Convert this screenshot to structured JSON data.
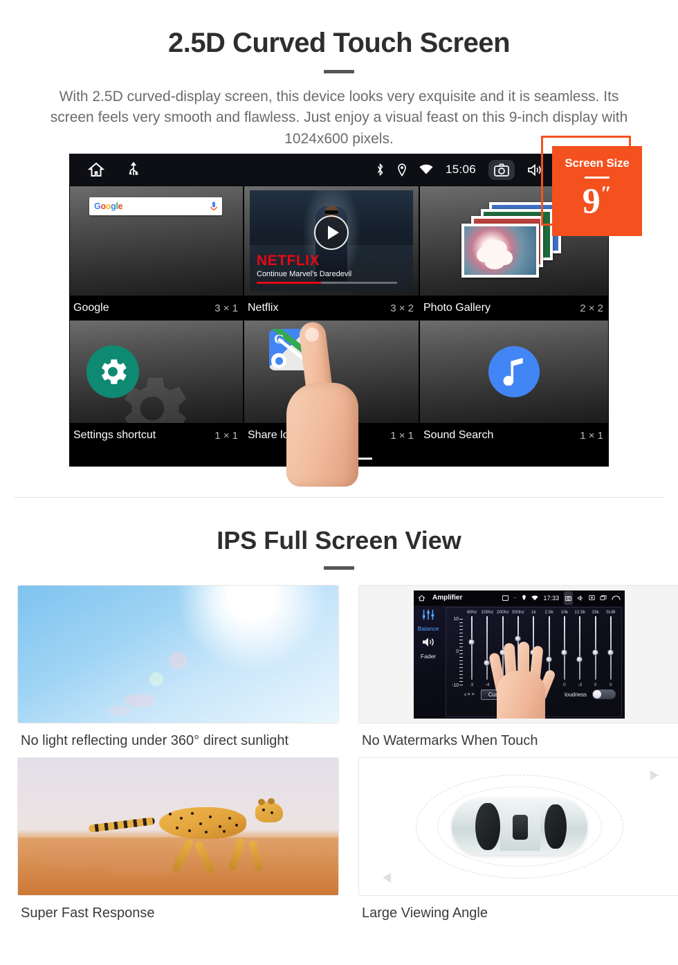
{
  "section1": {
    "title": "2.5D Curved Touch Screen",
    "description": "With 2.5D curved-display screen, this device looks very exquisite and it is seamless. Its screen feels very smooth and flawless. Just enjoy a visual feast on this 9-inch display with 1024x600 pixels.",
    "badge": {
      "label": "Screen Size",
      "value": "9",
      "unit": "″"
    },
    "accent_color": "#F4511E",
    "device": {
      "statusbar": {
        "time": "15:06",
        "left_icons": [
          "home-icon",
          "usb-icon"
        ],
        "right_icons": [
          "bluetooth-icon",
          "location-icon",
          "wifi-icon",
          "camera-icon",
          "volume-icon",
          "close-box-icon",
          "recents-icon"
        ]
      },
      "widgets": [
        {
          "name": "Google",
          "size": "3 × 1",
          "icon": "google-search-widget",
          "search_placeholder": ""
        },
        {
          "name": "Netflix",
          "size": "3 × 2",
          "icon": "netflix-widget",
          "brand": "NETFLIX",
          "subtitle": "Continue Marvel's Daredevil"
        },
        {
          "name": "Photo Gallery",
          "size": "2 × 2",
          "icon": "photo-gallery-widget"
        },
        {
          "name": "Settings shortcut",
          "size": "1 × 1",
          "icon": "settings-gear-icon"
        },
        {
          "name": "Share location",
          "size": "1 × 1",
          "icon": "google-maps-icon"
        },
        {
          "name": "Sound Search",
          "size": "1 × 1",
          "icon": "music-note-icon"
        }
      ],
      "page_indicator": {
        "count": 3,
        "active": 3
      }
    }
  },
  "section2": {
    "title": "IPS Full Screen View",
    "cards": [
      {
        "caption": "No light reflecting under 360° direct sunlight",
        "image": "sunlight-sky-photo"
      },
      {
        "caption": "No Watermarks When Touch",
        "image": "amplifier-equalizer-screen"
      },
      {
        "caption": "Super Fast Response",
        "image": "running-cheetah-photo"
      },
      {
        "caption": "Large Viewing Angle",
        "image": "car-top-view-diagram"
      }
    ],
    "amplifier": {
      "title": "Amplifier",
      "time": "17:33",
      "sidebar": [
        "Balance",
        "Fader"
      ],
      "bands": [
        "60hz",
        "100hz",
        "200hz",
        "500hz",
        "1k",
        "2.5k",
        "10k",
        "12.5k",
        "15k",
        "SUB"
      ],
      "values": [
        "3",
        "-4",
        "0",
        "0",
        "0",
        "-3",
        "0",
        "-3",
        "0",
        "0"
      ],
      "scale": {
        "max": "10",
        "mid": "0",
        "min": "-10"
      },
      "preset_button": "Custom",
      "loudness_label": "loudness",
      "back_icon": "back-arrow-icon"
    }
  }
}
